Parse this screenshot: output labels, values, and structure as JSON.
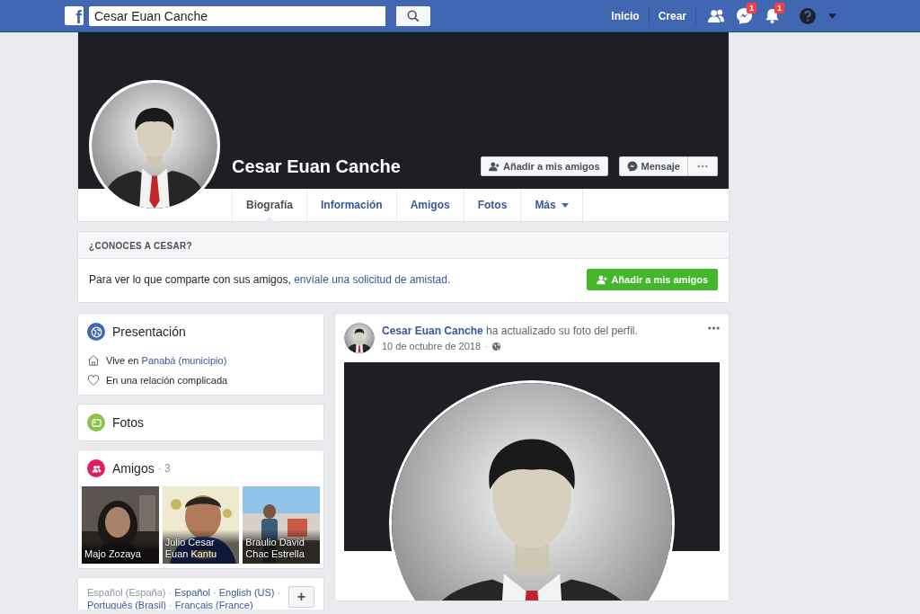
{
  "topbar": {
    "logo": "f",
    "search": {
      "value": "Cesar Euan Canche"
    },
    "nav": [
      {
        "label": "Inicio"
      },
      {
        "label": "Crear"
      }
    ],
    "icons": [
      {
        "kind": "friends"
      },
      {
        "kind": "messenger",
        "badge": "1"
      },
      {
        "kind": "notifications",
        "badge": "1"
      },
      {
        "kind": "help"
      },
      {
        "kind": "menu"
      }
    ]
  },
  "profile": {
    "name": "Cesar Euan Canche",
    "actions": [
      {
        "kind": "add",
        "label": "Añadir a mis amigos"
      },
      {
        "kind": "message",
        "label": "Mensaje"
      },
      {
        "kind": "more"
      }
    ],
    "tabs": [
      {
        "label": "Biografía",
        "selected": true
      },
      {
        "label": "Información",
        "selected": false
      },
      {
        "label": "Amigos",
        "selected": false
      },
      {
        "label": "Fotos",
        "selected": false
      },
      {
        "label": "Más",
        "selected": false,
        "dropdown": true
      }
    ]
  },
  "know_card": {
    "title": "¿CONOCES A CESAR?",
    "text": "Para ver lo que comparte con sus amigos, ",
    "link": "envíale una solicitud de amistad.",
    "button": "Añadir a mis amigos"
  },
  "intro": {
    "title": "Presentación",
    "items": [
      {
        "kind": "home",
        "text": "Vive en ",
        "link": "Panabá (municipio)"
      },
      {
        "kind": "heart",
        "text": "En una relación complicada"
      }
    ]
  },
  "photos": {
    "title": "Fotos"
  },
  "friends": {
    "title": "Amigos",
    "count": "· 3",
    "items": [
      {
        "name": "Majo Zozaya"
      },
      {
        "name": "Julio Cesar Euan Kantu"
      },
      {
        "name": "Braulio David Chac Estrella"
      }
    ]
  },
  "languages": {
    "separator": "·",
    "items": [
      {
        "label": "Español (España)",
        "current": true
      },
      {
        "label": "Español",
        "current": false
      },
      {
        "label": "English (US)",
        "current": false
      },
      {
        "label": "Português (Brasil)",
        "current": false
      },
      {
        "label": "Français (France)",
        "current": false
      }
    ],
    "button": "+"
  },
  "post": {
    "author": "Cesar Euan Canche",
    "action": "ha actualizado su foto del perfil.",
    "date": "10 de octubre de 2018",
    "separator": "·"
  }
}
